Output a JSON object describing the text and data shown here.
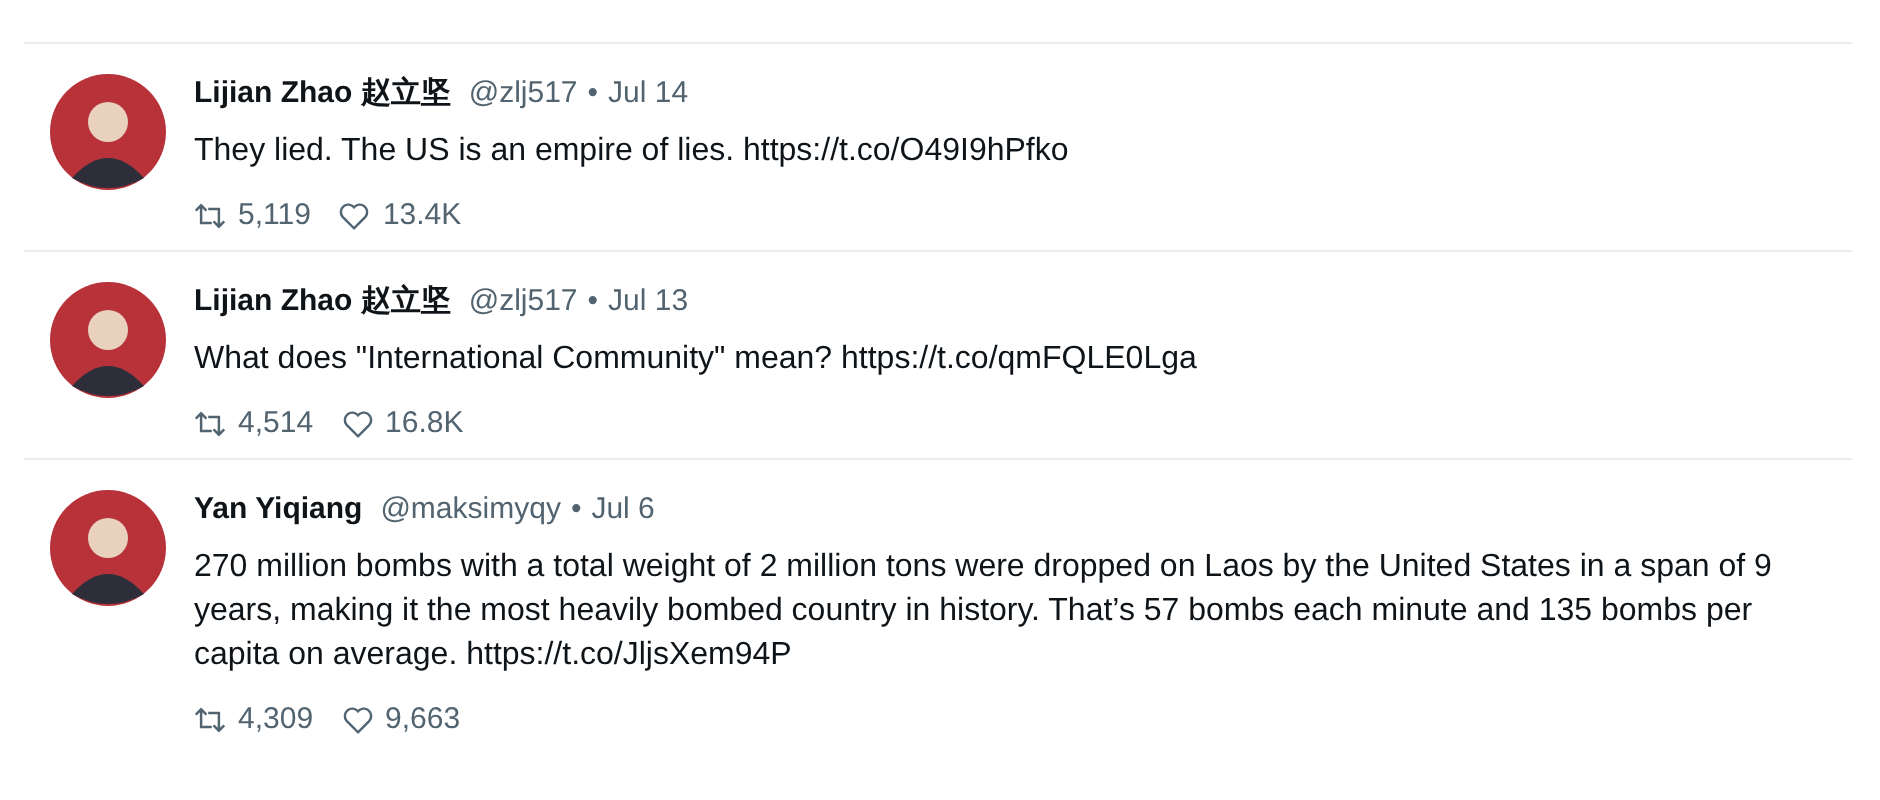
{
  "tweets": [
    {
      "name": "Lijian Zhao 赵立坚",
      "handle": "@zlj517",
      "date": "Jul 14",
      "text": "They lied. The US is an empire of lies. https://t.co/O49I9hPfko",
      "retweets": "5,119",
      "likes": "13.4K",
      "separator": "•"
    },
    {
      "name": "Lijian Zhao 赵立坚",
      "handle": "@zlj517",
      "date": "Jul 13",
      "text": "What does \"International Community\" mean? https://t.co/qmFQLE0Lga",
      "retweets": "4,514",
      "likes": "16.8K",
      "separator": "•"
    },
    {
      "name": "Yan Yiqiang",
      "handle": "@maksimyqy",
      "date": "Jul 6",
      "text": "270 million bombs with a total weight of 2 million tons were dropped on Laos by the United States in a span of 9 years, making it the most heavily bombed country in history. That’s 57 bombs each minute and 135 bombs per capita on average. https://t.co/JljsXem94P",
      "retweets": "4,309",
      "likes": "9,663",
      "separator": "•"
    }
  ]
}
